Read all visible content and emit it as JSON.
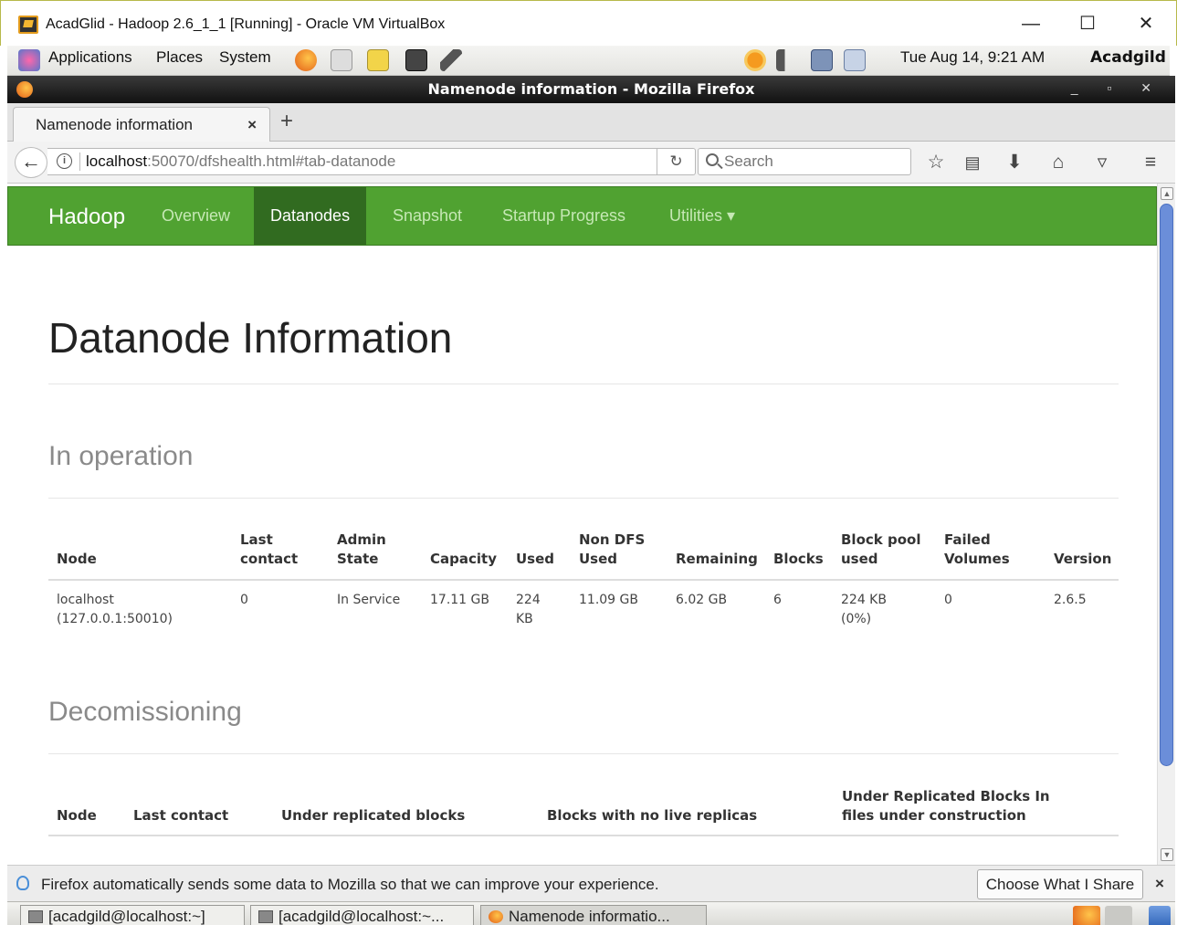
{
  "vbox": {
    "title": "AcadGlid - Hadoop 2.6_1_1 [Running] - Oracle VM VirtualBox",
    "minimize": "—",
    "maximize": "☐",
    "close": "✕"
  },
  "panel": {
    "applications": "Applications",
    "places": "Places",
    "system": "System",
    "datetime": "Tue Aug 14,  9:21 AM",
    "user": "Acadgild"
  },
  "firefox": {
    "window_title": "Namenode information - Mozilla Firefox",
    "window_controls": "_ ▫ ✕",
    "tab_label": "Namenode information",
    "tab_close": "×",
    "new_tab": "+",
    "url_host": "localhost",
    "url_rest": ":50070/dfshealth.html#tab-datanode",
    "search_placeholder": "Search"
  },
  "hadoop_nav": {
    "brand": "Hadoop",
    "items": [
      "Overview",
      "Datanodes",
      "Snapshot",
      "Startup Progress",
      "Utilities ▾"
    ],
    "active": "Datanodes"
  },
  "page": {
    "title": "Datanode Information",
    "in_operation": {
      "heading": "In operation",
      "headers": [
        "Node",
        "Last contact",
        "Admin State",
        "Capacity",
        "Used",
        "Non DFS Used",
        "Remaining",
        "Blocks",
        "Block pool used",
        "Failed Volumes",
        "Version"
      ],
      "rows": [
        {
          "node": "localhost (127.0.0.1:50010)",
          "last_contact": "0",
          "admin_state": "In Service",
          "capacity": "17.11 GB",
          "used": "224 KB",
          "non_dfs_used": "11.09 GB",
          "remaining": "6.02 GB",
          "blocks": "6",
          "block_pool_used": "224 KB (0%)",
          "failed_volumes": "0",
          "version": "2.6.5"
        }
      ]
    },
    "decommissioning": {
      "heading": "Decomissioning",
      "headers": [
        "Node",
        "Last contact",
        "Under replicated blocks",
        "Blocks with no live replicas",
        "Under Replicated Blocks In files under construction"
      ]
    }
  },
  "notification": {
    "text": "Firefox automatically sends some data to Mozilla so that we can improve your experience.",
    "button": "Choose What I Share",
    "close": "×"
  },
  "taskbar": {
    "tasks": [
      "[acadgild@localhost:~]",
      "[acadgild@localhost:~...",
      "Namenode informatio..."
    ]
  },
  "colors": {
    "hadoop_green": "#50a231",
    "hadoop_active": "#316b20",
    "scroll_thumb": "#6b8ed9"
  }
}
